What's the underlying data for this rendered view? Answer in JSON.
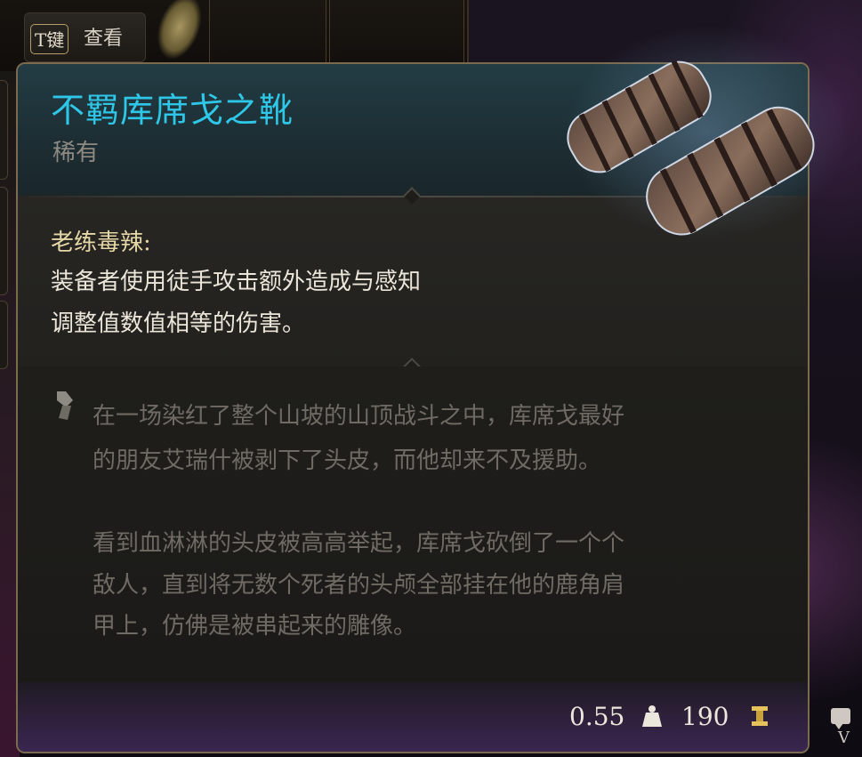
{
  "top_bar": {
    "key_hint": {
      "key": "T键",
      "action": "查看"
    }
  },
  "tooltip": {
    "item_name": "不羁库席戈之靴",
    "rarity": "稀有",
    "effect": {
      "title": "老练毒辣:",
      "lines": [
        "装备者使用徒手攻击额外造成与感知",
        "调整值数值相等的伤害。"
      ]
    },
    "lore": {
      "lines": [
        "在一场染红了整个山坡的山顶战斗之中，库席戈最好",
        "的朋友艾瑞什被剥下了头皮，而他却来不及援助。",
        "看到血淋淋的头皮被高高举起，库席戈砍倒了一个个",
        "敌人，直到将无数个死者的头颅全部挂在他的鹿角肩",
        "甲上，仿佛是被串起来的雕像。"
      ]
    },
    "footer": {
      "weight": "0.55",
      "weight_icon": "weight-icon",
      "value": "190",
      "value_icon": "gold-coin-icon"
    }
  },
  "chat_button": {
    "hotkey": "V"
  },
  "colors": {
    "item_name": "#2ec7e8",
    "rarity": "#8f8a82",
    "effect_title": "#e6d7a6",
    "effect_text": "#ece6da",
    "lore_text": "#6f6b64",
    "border": "#7b6a4d",
    "gold": "#e6c25a"
  }
}
